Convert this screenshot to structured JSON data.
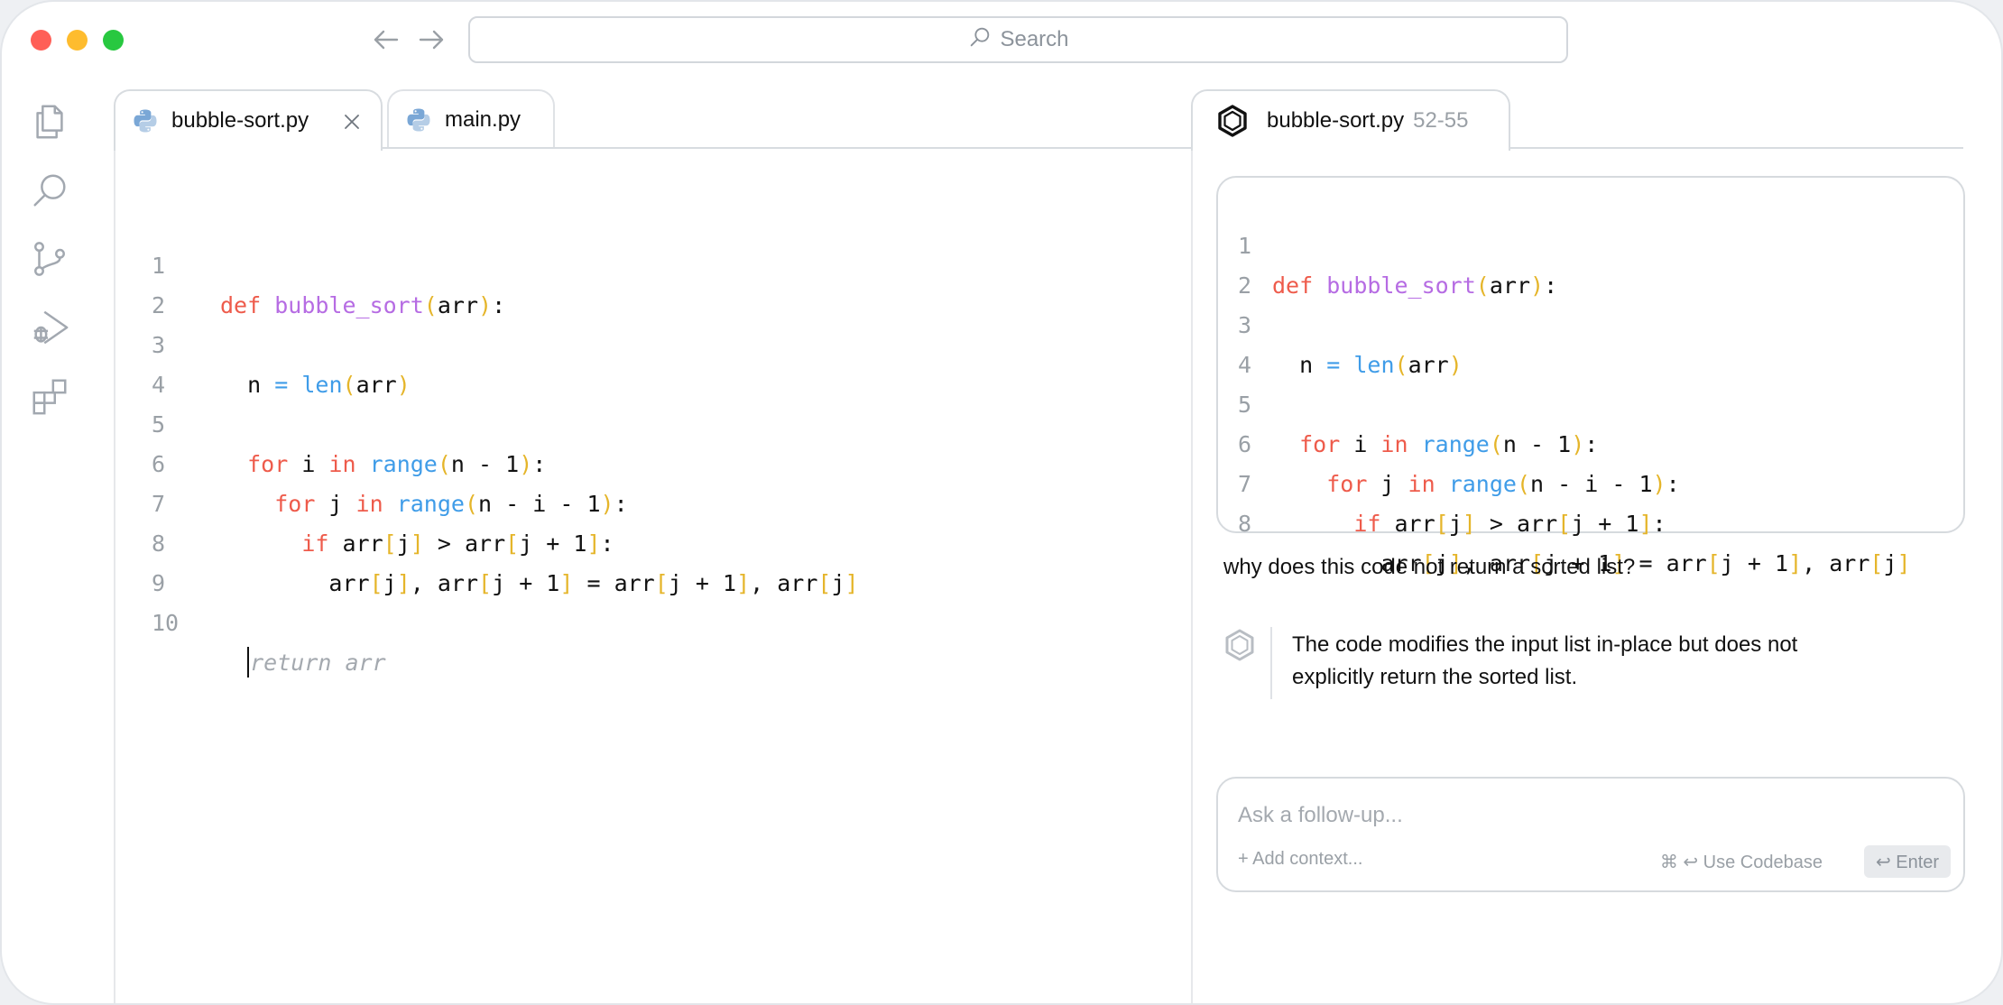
{
  "titlebar": {
    "search_placeholder": "Search"
  },
  "activity_bar": {
    "items": [
      "files-icon",
      "search-icon",
      "source-control-icon",
      "run-debug-icon",
      "extensions-icon"
    ]
  },
  "editor": {
    "tabs": [
      {
        "label": "bubble-sort.py",
        "active": true
      },
      {
        "label": "main.py",
        "active": false
      }
    ],
    "lines": [
      {
        "n": "1"
      },
      {
        "n": "2"
      },
      {
        "n": "3"
      },
      {
        "n": "4"
      },
      {
        "n": "5"
      },
      {
        "n": "6"
      },
      {
        "n": "7"
      },
      {
        "n": "8"
      },
      {
        "n": "9"
      },
      {
        "n": "10"
      }
    ],
    "ghost_suggestion": "return arr"
  },
  "chat": {
    "tab": {
      "file": "bubble-sort.py",
      "range": "52-55"
    },
    "snippet_lines": [
      "1",
      "2",
      "3",
      "4",
      "5",
      "6",
      "7",
      "8"
    ],
    "question": "why does this code not return a sorted list?",
    "answer": "The code modifies the input list in-place but does not explicitly return the sorted list.",
    "followup": {
      "placeholder": "Ask a follow-up...",
      "add_context": "+ Add context...",
      "use_codebase": "⌘ ↩ Use Codebase",
      "enter": "↩ Enter"
    }
  },
  "colors": {
    "keyword": "#ee5b4b",
    "function": "#b66ce3",
    "builtin": "#3f9ce8",
    "bracket": "#e5b52a",
    "traffic_red": "#ff5f57",
    "traffic_yellow": "#febc2e",
    "traffic_green": "#28c840"
  }
}
